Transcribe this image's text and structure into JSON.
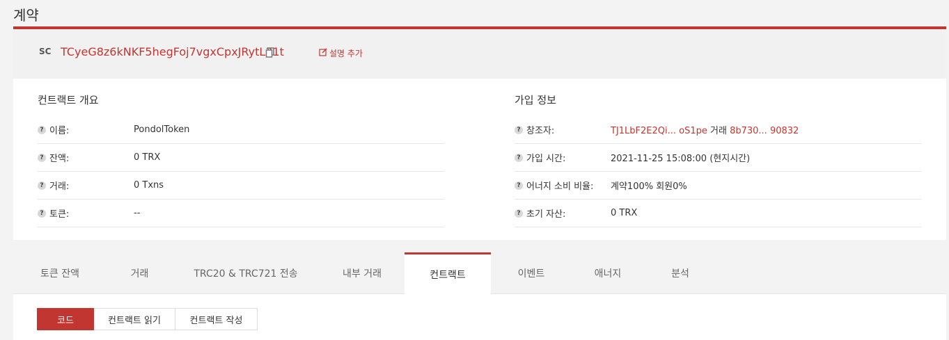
{
  "page": {
    "title": "계약"
  },
  "contract": {
    "badge": "SC",
    "address": "TCyeG8z6kNKF5hegFoj7vgxCpxJRytL31t",
    "add_desc_label": "설명 추가"
  },
  "overview": {
    "title": "컨트랙트 개요",
    "rows": [
      {
        "label": "이름:",
        "value": "PondolToken"
      },
      {
        "label": "잔액:",
        "value": "0 TRX"
      },
      {
        "label": "거래:",
        "value": "0  Txns"
      },
      {
        "label": "토큰:",
        "value": "--"
      }
    ]
  },
  "join_info": {
    "title": "가입 정보",
    "creator_label": "창조자:",
    "creator_link": "TJ1LbF2E2Qi... oS1pe",
    "creator_tx_label": "거래",
    "creator_tx_link": "8b730... 90832",
    "join_time_label": "가입 시간:",
    "join_time_value": "2021-11-25 15:08:00 (현지시간)",
    "energy_label": "어너지 소비 비율:",
    "energy_value": "계약100%  회원0%",
    "initial_label": "초기 자산:",
    "initial_value": "0 TRX"
  },
  "tabs": [
    {
      "label": "토큰 잔액"
    },
    {
      "label": "거래"
    },
    {
      "label": "TRC20 & TRC721 전송"
    },
    {
      "label": "내부 거래"
    },
    {
      "label": "컨트랙트",
      "active": true
    },
    {
      "label": "이벤트"
    },
    {
      "label": "애너지"
    },
    {
      "label": "분석"
    }
  ],
  "sub_tabs": [
    {
      "label": "코드",
      "active": true
    },
    {
      "label": "컨트랙트 읽기"
    },
    {
      "label": "컨트랙트 작성"
    }
  ],
  "colors": {
    "accent": "#c23631",
    "background": "#f3f3f3"
  },
  "icons": {
    "copy": "copy-icon",
    "edit": "edit-icon",
    "help": "help-icon"
  }
}
